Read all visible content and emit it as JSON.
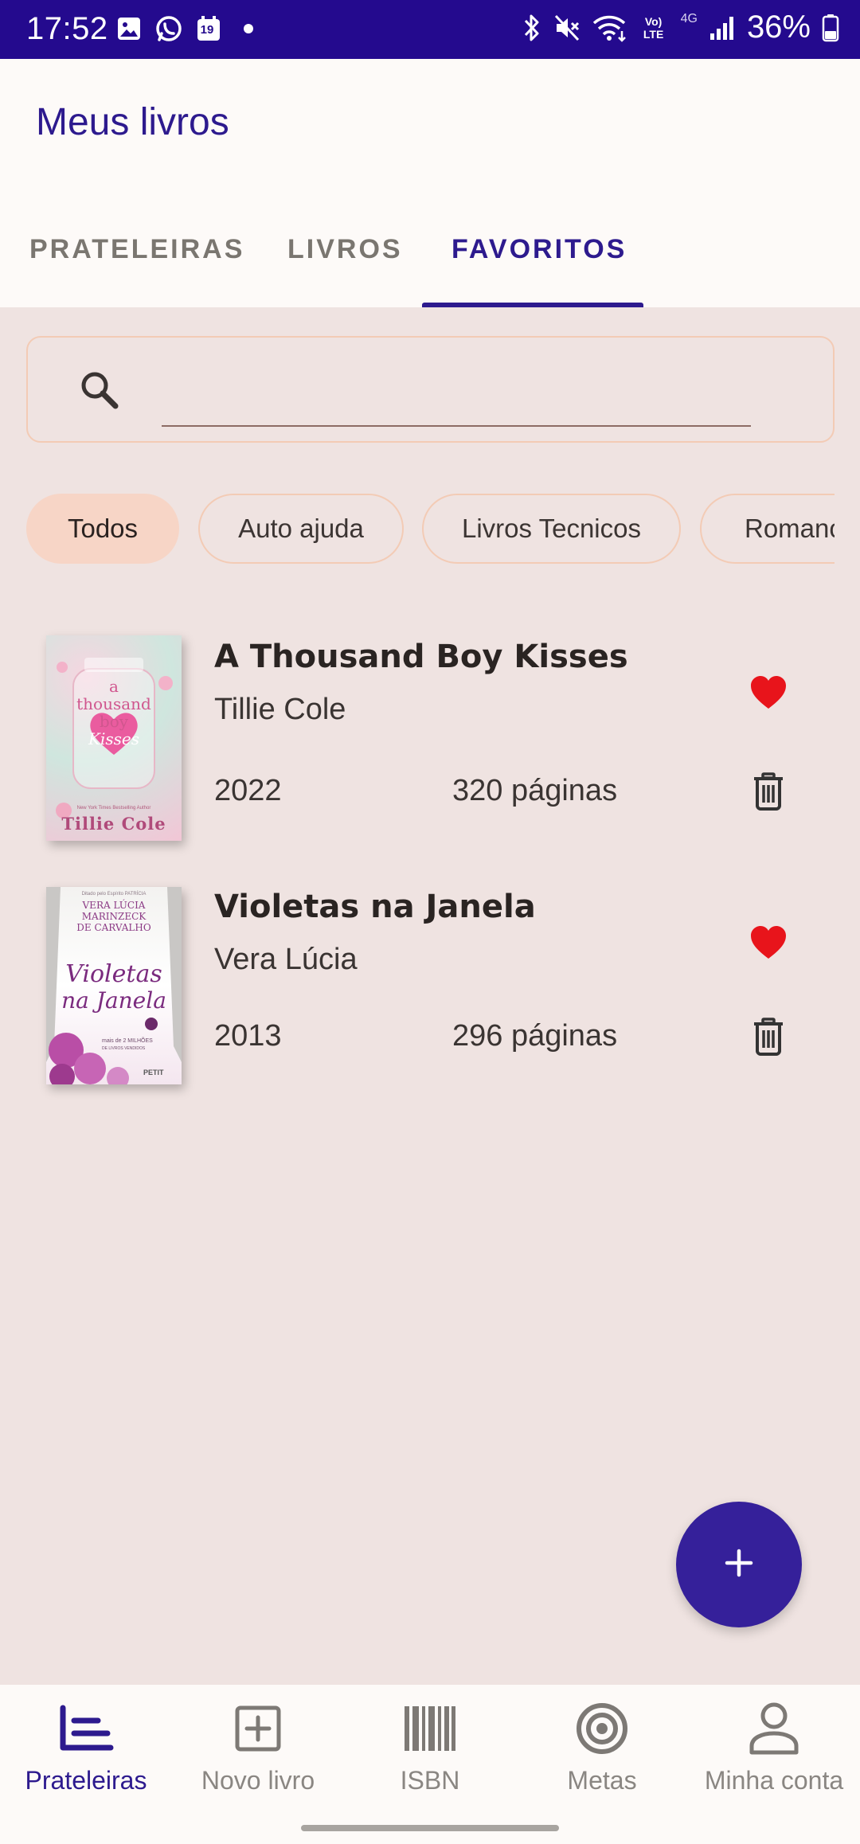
{
  "status_bar": {
    "time": "17:52",
    "battery": "36%",
    "left_icons": [
      "gallery-icon",
      "whatsapp-icon",
      "calendar-icon",
      "dot-icon"
    ],
    "calendar_day": "19",
    "right_icons": [
      "bluetooth-icon",
      "mute-icon",
      "wifi-icon",
      "volte-icon",
      "4g-icon",
      "signal-icon",
      "battery-icon"
    ],
    "volte_text": "Vo) LTE",
    "network_text": "4G"
  },
  "header": {
    "title": "Meus livros"
  },
  "tabs": [
    {
      "label": "PRATELEIRAS",
      "active": false
    },
    {
      "label": "LIVROS",
      "active": false
    },
    {
      "label": "FAVORITOS",
      "active": true
    }
  ],
  "search": {
    "value": "",
    "placeholder": ""
  },
  "chips": [
    {
      "label": "Todos",
      "selected": true
    },
    {
      "label": "Auto ajuda",
      "selected": false
    },
    {
      "label": "Livros Tecnicos",
      "selected": false
    },
    {
      "label": "Romance",
      "selected": false
    }
  ],
  "books": [
    {
      "title": "A Thousand Boy Kisses",
      "author": "Tillie Cole",
      "year": "2022",
      "pages": "320 páginas",
      "favorite": true,
      "cover": {
        "line1": "a",
        "line2": "thousand",
        "line3": "boy",
        "line4": "Kisses",
        "author": "Tillie Cole",
        "tagline": "New York Times Bestselling Author"
      }
    },
    {
      "title": "Violetas na Janela",
      "author": "Vera Lúcia",
      "year": "2013",
      "pages": "296 páginas",
      "favorite": true,
      "cover": {
        "author_line1": "VERA LÚCIA",
        "author_line2": "MARINZECK",
        "author_line3": "DE CARVALHO",
        "tagline": "Ditado pelo Espírito PATRÍCIA",
        "title_line1": "Violetas",
        "title_line2": "na Janela",
        "sales": "mais de 2 MILHÕES",
        "sales_sub": "DE LIVROS VENDIDOS",
        "publisher": "PETIT"
      }
    }
  ],
  "fab": {
    "icon": "plus-icon"
  },
  "bottom_nav": [
    {
      "label": "Prateleiras",
      "icon": "shelves-icon",
      "active": true
    },
    {
      "label": "Novo livro",
      "icon": "add-box-icon",
      "active": false
    },
    {
      "label": "ISBN",
      "icon": "barcode-icon",
      "active": false
    },
    {
      "label": "Metas",
      "icon": "target-icon",
      "active": false
    },
    {
      "label": "Minha conta",
      "icon": "person-icon",
      "active": false
    }
  ],
  "colors": {
    "primary": "#2d1a8e",
    "status_bar": "#240a8e",
    "background": "#efe3e1",
    "surface": "#fdfaf8",
    "chip_selected": "#f7d5c6",
    "outline": "#f3cbb5",
    "favorite": "#e8141b",
    "fab": "#35209a"
  }
}
